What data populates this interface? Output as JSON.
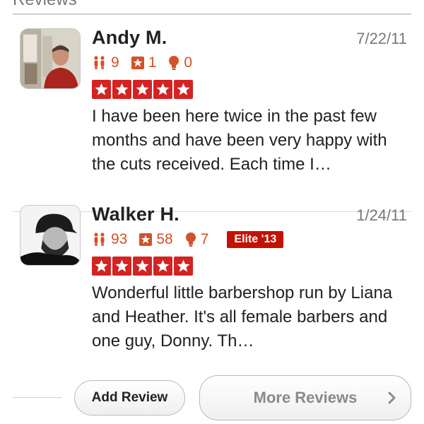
{
  "section": {
    "title": "Reviews"
  },
  "reviews": [
    {
      "name": "Andy M.",
      "date": "7/22/11",
      "friends": "9",
      "reviews_count": "1",
      "photos": "0",
      "elite": "",
      "rating": 5,
      "excerpt": "I have been here twice in the past few months and have been very happy with the cuts received. Each time I…"
    },
    {
      "name": "Walker H.",
      "date": "1/24/11",
      "friends": "93",
      "reviews_count": "58",
      "photos": "7",
      "elite": "Elite '13",
      "rating": 5,
      "excerpt": "Wonderful little barbershop run by Liana and Heather. It's all female barbers and one guy, Donny. Th…"
    }
  ],
  "footer": {
    "add_review_label": "Add Review",
    "more_reviews_label": "More Reviews"
  },
  "icons": {
    "friends": "friends-icon",
    "reviews": "star-box-icon",
    "photos": "lightbulb-icon",
    "rating_star": "star-icon",
    "more": "chevron-right-icon"
  },
  "colors": {
    "accent": "#d32323",
    "stat_text": "#d2522a",
    "elite_badge": "#c41200",
    "muted_text": "#777777"
  }
}
